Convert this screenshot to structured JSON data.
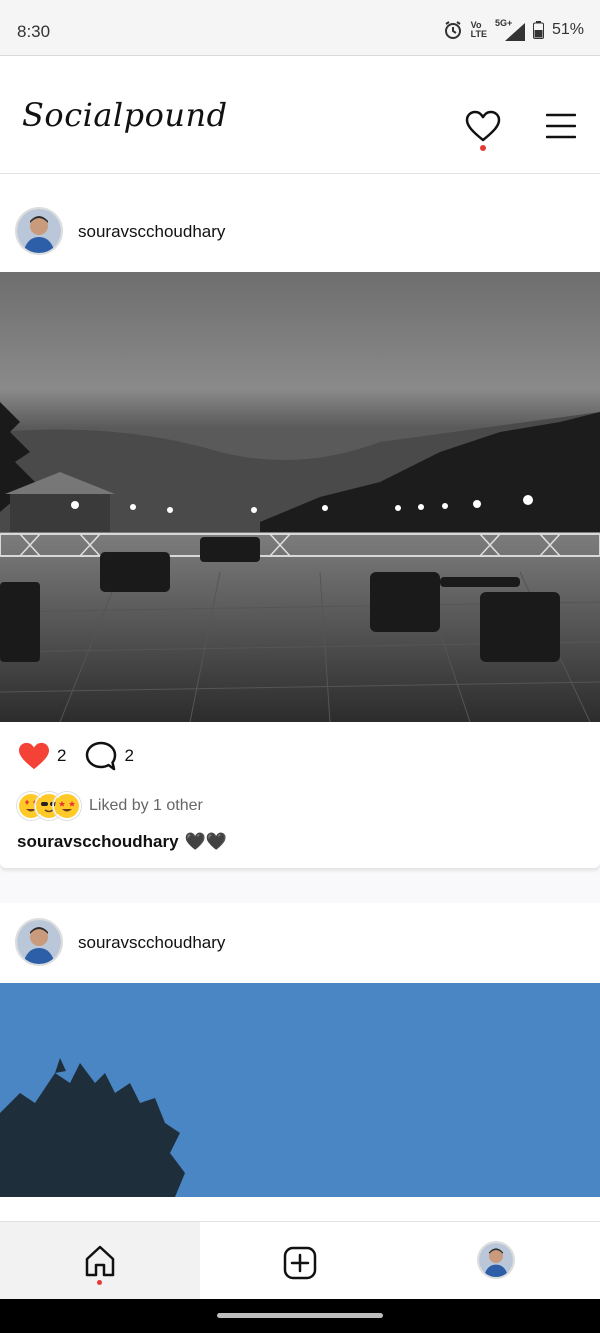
{
  "status_bar": {
    "time": "8:30",
    "network_top": "Vo",
    "network_bottom": "LTE",
    "network_type": "5G+",
    "battery": "51%",
    "icons": [
      "alarm-icon",
      "signal-icon",
      "battery-icon"
    ]
  },
  "header": {
    "logo": "Socialpound",
    "icons": [
      "heart-icon",
      "menu-icon"
    ],
    "notification_color": "#e53935"
  },
  "feed": {
    "posts": [
      {
        "username": "souravscchoudhary",
        "likes": "2",
        "comments": "2",
        "liked_by": "Liked by 1 other",
        "caption_user": "souravscchoudhary",
        "caption_text": "🖤🖤"
      },
      {
        "username": "souravscchoudhary"
      }
    ]
  },
  "bottom_nav": {
    "items": [
      "home-icon",
      "add-post-icon",
      "profile-avatar"
    ]
  },
  "colors": {
    "like": "#e53935",
    "accent_dot": "#e53935"
  }
}
